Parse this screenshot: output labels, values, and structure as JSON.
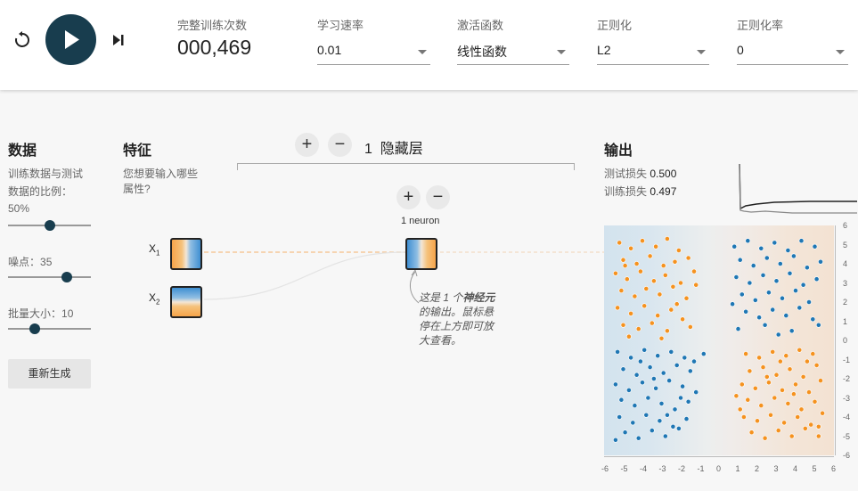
{
  "toolbar": {
    "epoch_label": "完整训练次数",
    "epoch_value": "000,469",
    "learning_rate_label": "学习速率",
    "learning_rate_value": "0.01",
    "activation_label": "激活函数",
    "activation_value": "线性函数",
    "regularization_label": "正则化",
    "regularization_value": "L2",
    "reg_rate_label": "正则化率",
    "reg_rate_value": "0",
    "icons": [
      "reset-icon",
      "play-icon",
      "step-icon"
    ]
  },
  "data_panel": {
    "title": "数据",
    "ratio_label_1": "训练数据与测试",
    "ratio_label_2": "数据的比例：",
    "ratio_value": "50%",
    "ratio_fraction": 0.5,
    "noise_label": "噪点：",
    "noise_value": "35",
    "noise_fraction": 0.7,
    "batch_label": "批量大小：",
    "batch_value": "10",
    "batch_fraction": 0.3,
    "regenerate_label": "重新生成"
  },
  "features": {
    "title": "特征",
    "question_1": "您想要输入哪些",
    "question_2": "属性?",
    "x1_label": "X",
    "x1_sub": "1",
    "x2_label": "X",
    "x2_sub": "2"
  },
  "hidden": {
    "layer_count": "1",
    "layer_label": "隐藏层",
    "neuron_label": "1 neuron",
    "tooltip_1": "这是 1 个",
    "tooltip_bold": "神经元",
    "tooltip_2": "的输出。鼠标悬",
    "tooltip_3": "停在上方即可放",
    "tooltip_4": "大查看。"
  },
  "output": {
    "title": "输出",
    "test_loss_label": "测试损失",
    "test_loss_value": "0.500",
    "train_loss_label": "训练损失",
    "train_loss_value": "0.497"
  },
  "chart_data": {
    "type": "scatter",
    "x_ticks": [
      "-6",
      "-5",
      "-4",
      "-3",
      "-2",
      "-1",
      "0",
      "1",
      "2",
      "3",
      "4",
      "5",
      "6"
    ],
    "y_ticks": [
      "6",
      "5",
      "4",
      "3",
      "2",
      "1",
      "0",
      "-1",
      "-2",
      "-3",
      "-4",
      "-5",
      "-6"
    ],
    "xlim": [
      -6,
      6
    ],
    "ylim": [
      -6,
      6
    ],
    "colors": {
      "blue": "#1f77b4",
      "orange": "#f5921f"
    },
    "series": [
      {
        "color": "orange",
        "points": [
          [
            -5.2,
            5.1
          ],
          [
            -4.6,
            4.8
          ],
          [
            -4.0,
            5.2
          ],
          [
            -3.3,
            4.9
          ],
          [
            -2.7,
            5.3
          ],
          [
            -2.1,
            4.7
          ],
          [
            -5.0,
            4.2
          ],
          [
            -4.3,
            4.0
          ],
          [
            -3.6,
            4.4
          ],
          [
            -2.9,
            3.9
          ],
          [
            -2.3,
            4.1
          ],
          [
            -1.6,
            4.3
          ],
          [
            -5.4,
            3.5
          ],
          [
            -4.8,
            3.2
          ],
          [
            -4.1,
            3.6
          ],
          [
            -3.4,
            3.1
          ],
          [
            -2.8,
            3.4
          ],
          [
            -2.0,
            3.0
          ],
          [
            -1.3,
            3.6
          ],
          [
            -5.1,
            2.6
          ],
          [
            -4.4,
            2.3
          ],
          [
            -3.8,
            2.7
          ],
          [
            -3.1,
            2.4
          ],
          [
            -2.4,
            2.8
          ],
          [
            -1.7,
            2.2
          ],
          [
            -5.3,
            1.7
          ],
          [
            -4.6,
            1.4
          ],
          [
            -3.9,
            1.8
          ],
          [
            -3.2,
            1.3
          ],
          [
            -2.5,
            1.6
          ],
          [
            -1.9,
            1.1
          ],
          [
            -5.0,
            0.8
          ],
          [
            -4.2,
            0.6
          ],
          [
            -3.5,
            0.9
          ],
          [
            -2.7,
            0.5
          ],
          [
            -1.5,
            0.7
          ],
          [
            -4.7,
            0.2
          ],
          [
            -3.0,
            0.1
          ],
          [
            -1.2,
            2.9
          ],
          [
            -4.9,
            3.9
          ],
          [
            -2.2,
            1.9
          ],
          [
            1.4,
            -0.7
          ],
          [
            2.1,
            -0.9
          ],
          [
            2.8,
            -0.6
          ],
          [
            3.5,
            -0.8
          ],
          [
            4.2,
            -0.5
          ],
          [
            4.9,
            -0.7
          ],
          [
            1.6,
            -1.6
          ],
          [
            2.3,
            -1.4
          ],
          [
            3.0,
            -1.8
          ],
          [
            3.7,
            -1.5
          ],
          [
            4.4,
            -1.9
          ],
          [
            5.1,
            -1.3
          ],
          [
            1.2,
            -2.3
          ],
          [
            1.9,
            -2.5
          ],
          [
            2.6,
            -2.2
          ],
          [
            3.3,
            -2.6
          ],
          [
            4.0,
            -2.3
          ],
          [
            4.7,
            -2.7
          ],
          [
            5.3,
            -2.1
          ],
          [
            1.5,
            -3.1
          ],
          [
            2.2,
            -3.4
          ],
          [
            2.9,
            -3.0
          ],
          [
            3.6,
            -3.3
          ],
          [
            4.3,
            -3.6
          ],
          [
            5.0,
            -3.2
          ],
          [
            1.3,
            -4.0
          ],
          [
            2.0,
            -4.2
          ],
          [
            2.7,
            -3.9
          ],
          [
            3.4,
            -4.3
          ],
          [
            4.1,
            -4.0
          ],
          [
            4.8,
            -4.4
          ],
          [
            5.4,
            -3.8
          ],
          [
            1.7,
            -4.8
          ],
          [
            2.4,
            -5.1
          ],
          [
            3.1,
            -4.7
          ],
          [
            3.8,
            -5.0
          ],
          [
            4.5,
            -4.6
          ],
          [
            5.2,
            -5.0
          ],
          [
            0.9,
            -2.9
          ],
          [
            3.2,
            -1.1
          ],
          [
            4.6,
            -1.1
          ],
          [
            2.5,
            -1.9
          ],
          [
            1.1,
            -3.6
          ],
          [
            3.9,
            -2.8
          ],
          [
            5.2,
            -4.5
          ]
        ]
      },
      {
        "color": "blue",
        "points": [
          [
            0.8,
            4.9
          ],
          [
            1.5,
            5.2
          ],
          [
            2.2,
            4.8
          ],
          [
            2.9,
            5.1
          ],
          [
            3.6,
            4.7
          ],
          [
            4.3,
            5.2
          ],
          [
            5.0,
            4.9
          ],
          [
            1.1,
            4.2
          ],
          [
            1.8,
            3.9
          ],
          [
            2.5,
            4.3
          ],
          [
            3.2,
            4.0
          ],
          [
            3.9,
            4.4
          ],
          [
            4.6,
            3.8
          ],
          [
            5.3,
            4.1
          ],
          [
            0.9,
            3.3
          ],
          [
            1.6,
            3.0
          ],
          [
            2.3,
            3.4
          ],
          [
            3.0,
            3.1
          ],
          [
            3.7,
            3.5
          ],
          [
            4.4,
            2.9
          ],
          [
            5.1,
            3.2
          ],
          [
            1.2,
            2.4
          ],
          [
            1.9,
            2.1
          ],
          [
            2.6,
            2.5
          ],
          [
            3.3,
            2.2
          ],
          [
            4.0,
            2.6
          ],
          [
            4.7,
            2.0
          ],
          [
            1.4,
            1.5
          ],
          [
            2.1,
            1.2
          ],
          [
            2.8,
            1.6
          ],
          [
            3.5,
            1.3
          ],
          [
            4.2,
            1.7
          ],
          [
            4.9,
            1.1
          ],
          [
            1.0,
            0.6
          ],
          [
            2.4,
            0.8
          ],
          [
            3.8,
            0.5
          ],
          [
            5.2,
            0.8
          ],
          [
            0.7,
            1.9
          ],
          [
            3.1,
            0.3
          ],
          [
            -5.3,
            -0.6
          ],
          [
            -4.6,
            -0.9
          ],
          [
            -3.9,
            -0.5
          ],
          [
            -3.2,
            -0.8
          ],
          [
            -2.5,
            -0.6
          ],
          [
            -1.8,
            -0.9
          ],
          [
            -5.0,
            -1.5
          ],
          [
            -4.3,
            -1.8
          ],
          [
            -3.6,
            -1.4
          ],
          [
            -2.9,
            -1.7
          ],
          [
            -2.2,
            -1.3
          ],
          [
            -1.5,
            -1.6
          ],
          [
            -5.4,
            -2.3
          ],
          [
            -4.7,
            -2.6
          ],
          [
            -4.0,
            -2.2
          ],
          [
            -3.3,
            -2.5
          ],
          [
            -2.6,
            -2.1
          ],
          [
            -1.9,
            -2.4
          ],
          [
            -1.2,
            -2.7
          ],
          [
            -5.1,
            -3.1
          ],
          [
            -4.4,
            -3.4
          ],
          [
            -3.7,
            -3.0
          ],
          [
            -3.0,
            -3.3
          ],
          [
            -2.3,
            -3.6
          ],
          [
            -1.6,
            -3.2
          ],
          [
            -5.2,
            -4.0
          ],
          [
            -4.5,
            -4.3
          ],
          [
            -3.8,
            -3.9
          ],
          [
            -3.1,
            -4.2
          ],
          [
            -2.4,
            -4.5
          ],
          [
            -1.7,
            -4.1
          ],
          [
            -4.9,
            -4.8
          ],
          [
            -4.2,
            -5.1
          ],
          [
            -3.5,
            -4.7
          ],
          [
            -2.8,
            -5.0
          ],
          [
            -2.1,
            -4.6
          ],
          [
            -5.4,
            -5.2
          ],
          [
            -1.3,
            -1.1
          ],
          [
            -0.8,
            -0.7
          ],
          [
            -3.4,
            -2.0
          ],
          [
            -2.0,
            -3.0
          ],
          [
            -4.1,
            -1.1
          ],
          [
            -2.7,
            -3.9
          ]
        ]
      }
    ]
  }
}
